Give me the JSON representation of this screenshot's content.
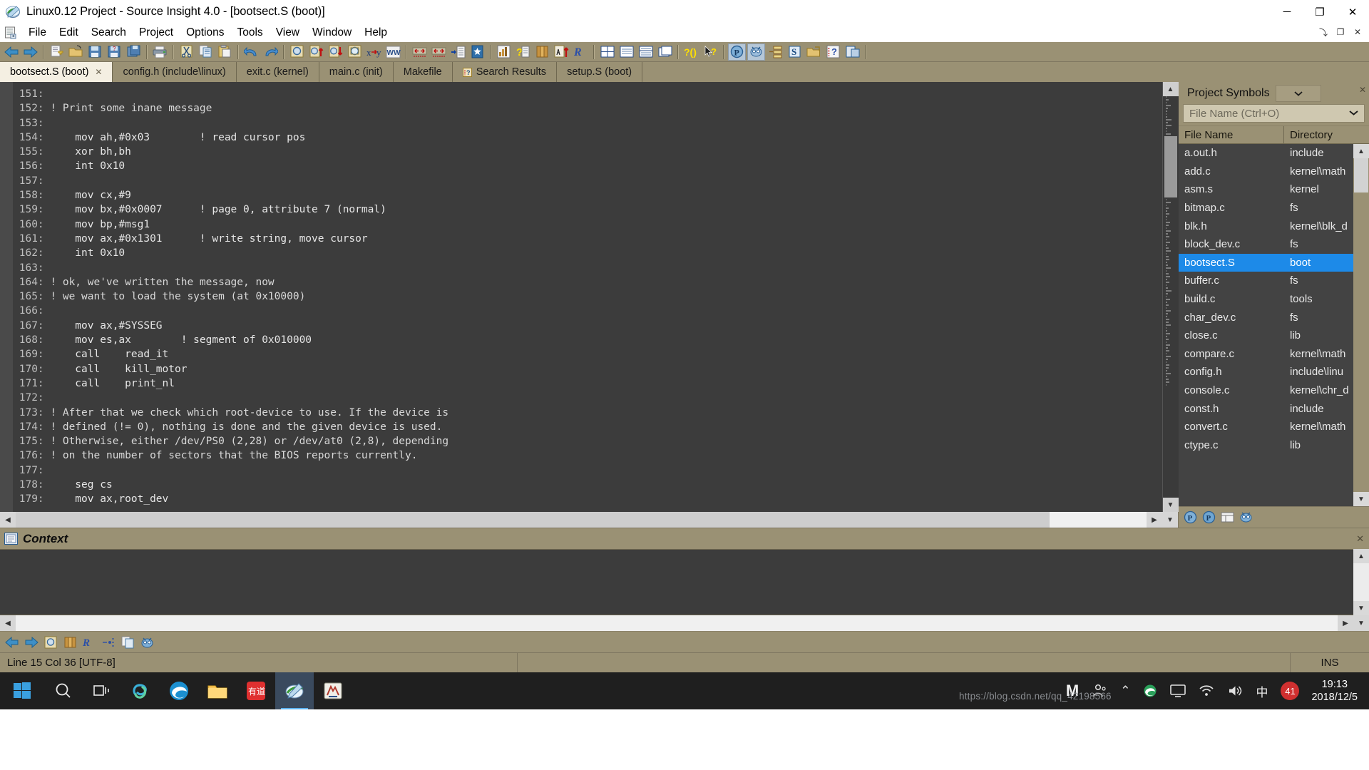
{
  "window": {
    "title": "Linux0.12 Project - Source Insight 4.0 - [bootsect.S (boot)]",
    "app_icon": "source-insight-icon",
    "minimize": "─",
    "maximize": "❐",
    "close": "✕"
  },
  "menu": {
    "doc_icon": "document-icon",
    "items": [
      "File",
      "Edit",
      "Search",
      "Project",
      "Options",
      "Tools",
      "View",
      "Window",
      "Help"
    ],
    "mdi": {
      "restore": "⤵",
      "maximize": "❐",
      "close": "✕"
    }
  },
  "toolbar": {
    "groups": [
      [
        "back-arrow-icon",
        "forward-arrow-icon"
      ],
      [
        "new-file-icon",
        "open-folder-icon",
        "save-icon",
        "save-as-icon",
        "save-all-icon",
        "print-icon"
      ],
      [
        "cut-icon",
        "copy-icon",
        "paste-icon",
        "undo-icon",
        "redo-icon"
      ],
      [
        "find-icon",
        "find-up-icon",
        "find-down-icon",
        "find-in-files-icon",
        "replace-icon",
        "search-web-icon"
      ],
      [
        "jump-left-icon",
        "jump-right-icon",
        "goto-line-icon",
        "bookmark-icon"
      ],
      [
        "symbol-window-icon",
        "context-help-icon",
        "reference-icon",
        "browse-icon",
        "relation-icon"
      ],
      [
        "tile-windows-icon",
        "window-full-icon",
        "window-split-icon",
        "window-cascade-icon"
      ],
      [
        "syntax-format-icon",
        "smart-pointer-icon"
      ],
      [
        "project-icon",
        "project-settings-icon",
        "outline-icon",
        "source-links-icon",
        "folder-links-icon",
        "highlight-icon",
        "panels-icon"
      ]
    ]
  },
  "tabs": [
    {
      "label": "bootsect.S (boot)",
      "selected": true,
      "closable": true,
      "icon": null
    },
    {
      "label": "config.h (include\\linux)",
      "selected": false,
      "closable": false,
      "icon": null
    },
    {
      "label": "exit.c (kernel)",
      "selected": false,
      "closable": false,
      "icon": null
    },
    {
      "label": "main.c (init)",
      "selected": false,
      "closable": false,
      "icon": null
    },
    {
      "label": "Makefile",
      "selected": false,
      "closable": false,
      "icon": null
    },
    {
      "label": "Search Results",
      "selected": false,
      "closable": false,
      "icon": "search-results-icon"
    },
    {
      "label": "setup.S (boot)",
      "selected": false,
      "closable": false,
      "icon": null
    }
  ],
  "editor": {
    "language": "assembly",
    "lines": [
      {
        "num": "151",
        "text": ""
      },
      {
        "num": "152",
        "text": "! Print some inane message"
      },
      {
        "num": "153",
        "text": ""
      },
      {
        "num": "154",
        "text": "    mov ah,#0x03        ! read cursor pos"
      },
      {
        "num": "155",
        "text": "    xor bh,bh"
      },
      {
        "num": "156",
        "text": "    int 0x10"
      },
      {
        "num": "157",
        "text": ""
      },
      {
        "num": "158",
        "text": "    mov cx,#9"
      },
      {
        "num": "159",
        "text": "    mov bx,#0x0007      ! page 0, attribute 7 (normal)"
      },
      {
        "num": "160",
        "text": "    mov bp,#msg1"
      },
      {
        "num": "161",
        "text": "    mov ax,#0x1301      ! write string, move cursor"
      },
      {
        "num": "162",
        "text": "    int 0x10"
      },
      {
        "num": "163",
        "text": ""
      },
      {
        "num": "164",
        "text": "! ok, we've written the message, now"
      },
      {
        "num": "165",
        "text": "! we want to load the system (at 0x10000)"
      },
      {
        "num": "166",
        "text": ""
      },
      {
        "num": "167",
        "text": "    mov ax,#SYSSEG"
      },
      {
        "num": "168",
        "text": "    mov es,ax        ! segment of 0x010000"
      },
      {
        "num": "169",
        "text": "    call    read_it"
      },
      {
        "num": "170",
        "text": "    call    kill_motor"
      },
      {
        "num": "171",
        "text": "    call    print_nl"
      },
      {
        "num": "172",
        "text": ""
      },
      {
        "num": "173",
        "text": "! After that we check which root-device to use. If the device is"
      },
      {
        "num": "174",
        "text": "! defined (!= 0), nothing is done and the given device is used."
      },
      {
        "num": "175",
        "text": "! Otherwise, either /dev/PS0 (2,28) or /dev/at0 (2,8), depending"
      },
      {
        "num": "176",
        "text": "! on the number of sectors that the BIOS reports currently."
      },
      {
        "num": "177",
        "text": ""
      },
      {
        "num": "178",
        "text": "    seg cs"
      },
      {
        "num": "179",
        "text": "    mov ax,root_dev"
      }
    ]
  },
  "right_panel": {
    "title": "Project Symbols",
    "dropdown_icon": "chevron-down-icon",
    "close_icon": "close-panel-icon",
    "search": {
      "placeholder": "File Name (Ctrl+O)",
      "value": "",
      "chevron": "chevron-down-icon"
    },
    "columns": [
      "File Name",
      "Directory"
    ],
    "rows": [
      {
        "file": "a.out.h",
        "dir": "include",
        "selected": false
      },
      {
        "file": "add.c",
        "dir": "kernel\\math",
        "selected": false
      },
      {
        "file": "asm.s",
        "dir": "kernel",
        "selected": false
      },
      {
        "file": "bitmap.c",
        "dir": "fs",
        "selected": false
      },
      {
        "file": "blk.h",
        "dir": "kernel\\blk_d",
        "selected": false
      },
      {
        "file": "block_dev.c",
        "dir": "fs",
        "selected": false
      },
      {
        "file": "bootsect.S",
        "dir": "boot",
        "selected": true
      },
      {
        "file": "buffer.c",
        "dir": "fs",
        "selected": false
      },
      {
        "file": "build.c",
        "dir": "tools",
        "selected": false
      },
      {
        "file": "char_dev.c",
        "dir": "fs",
        "selected": false
      },
      {
        "file": "close.c",
        "dir": "lib",
        "selected": false
      },
      {
        "file": "compare.c",
        "dir": "kernel\\math",
        "selected": false
      },
      {
        "file": "config.h",
        "dir": "include\\linu",
        "selected": false
      },
      {
        "file": "console.c",
        "dir": "kernel\\chr_d",
        "selected": false
      },
      {
        "file": "const.h",
        "dir": "include",
        "selected": false
      },
      {
        "file": "convert.c",
        "dir": "kernel\\math",
        "selected": false
      },
      {
        "file": "ctype.c",
        "dir": "lib",
        "selected": false
      }
    ],
    "bottom_buttons": [
      "project-symbols-icon",
      "project-files-icon",
      "contents-icon",
      "options-icon"
    ]
  },
  "context_panel": {
    "icon": "context-icon",
    "title": "Context",
    "close_icon": "close-panel-icon",
    "content": "",
    "toolbar_buttons": [
      "back-arrow-icon",
      "forward-arrow-icon",
      "lookup-icon",
      "book-icon",
      "link-icon",
      "more-icon",
      "copy-icon",
      "options-icon"
    ]
  },
  "status_bar": {
    "position": "Line 15  Col 36   [UTF-8]",
    "middle": "",
    "mode": "INS"
  },
  "taskbar": {
    "start_icon": "windows-start-icon",
    "search_icon": "search-circle-icon",
    "taskview_icon": "task-view-icon",
    "apps": [
      {
        "name": "sogou-pinyin-icon",
        "active": false
      },
      {
        "name": "edge-browser-icon",
        "active": false
      },
      {
        "name": "file-explorer-icon",
        "active": false
      },
      {
        "name": "youdao-dict-icon",
        "active": false
      },
      {
        "name": "source-insight-icon",
        "active": true
      },
      {
        "name": "archive-tool-icon",
        "active": false
      }
    ],
    "tray": {
      "m_icon": "M",
      "people_icon": "people-icon",
      "chevron_up": "⌃",
      "edge_icon": "edge-tray-icon",
      "monitor_icon": "monitor-icon",
      "network_icon": "wifi-icon",
      "volume_icon": "speaker-icon",
      "ime_label": "中",
      "badge_count": "41",
      "time": "19:13",
      "date": "2018/12/5"
    }
  },
  "watermark": "https://blog.csdn.net/qq_42198566",
  "colors": {
    "chrome": "#9a9174",
    "editor_bg": "#3c3c3c",
    "selection": "#1d8ae8",
    "tab_selected": "#f4efe2",
    "taskbar": "#1f1f1f"
  }
}
